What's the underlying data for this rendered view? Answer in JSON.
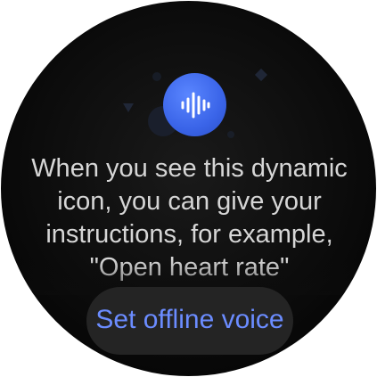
{
  "screen": {
    "icon": "voice-wave-icon",
    "accent_color": "#3a64e8",
    "message": "When you see this dynamic\nicon, you can give your\ninstructions, for example,\n\"Open heart rate\"",
    "action_label": "Set offline voice",
    "action_color": "#6b8cff"
  }
}
